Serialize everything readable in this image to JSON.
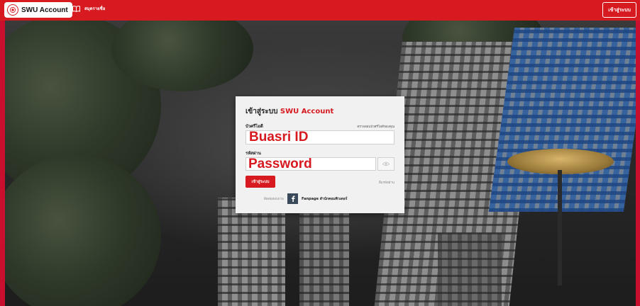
{
  "header": {
    "brand": "SWU Account",
    "nav_link": "สมุดรายชื่อ",
    "login_button": "เข้าสู่ระบบ"
  },
  "login_card": {
    "title_prefix": "เข้าสู่ระบบ ",
    "title_accent": "SWU Account",
    "id_label": "บัวศรีไอดี",
    "check_link": "ตรวจสอบบัวศรีไอดีของคุณ",
    "id_value": "Buasri ID",
    "password_label": "รหัสผ่าน",
    "password_value": "Password",
    "submit_label": "เข้าสู่ระบบ",
    "forgot_link": "ลืมรหัสผ่าน",
    "contact_label": "ติดต่อสอบถาม",
    "fanpage_label": "Fanpage สำนักคอมพิวเตอร์"
  },
  "colors": {
    "brand_red": "#d71920",
    "card_bg": "#f1f1f1"
  },
  "icons": {
    "brand": "swu-logo-icon",
    "nav": "book-icon",
    "password_toggle": "eye-icon",
    "fanpage": "facebook-icon"
  }
}
